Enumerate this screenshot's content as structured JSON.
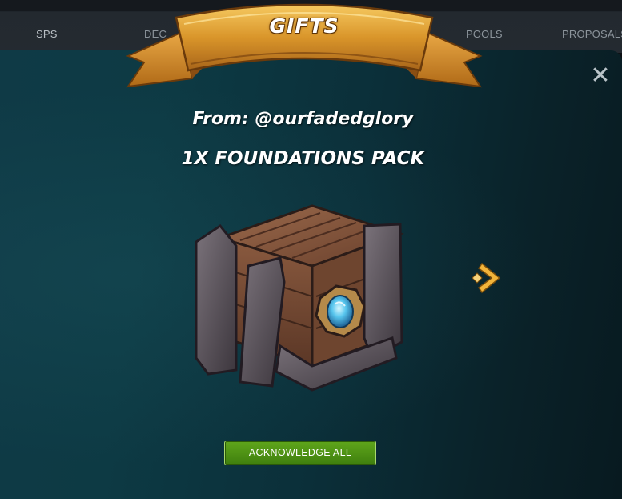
{
  "nav": {
    "items": [
      {
        "label": "SPS",
        "active": true
      },
      {
        "label": "DEC",
        "active": false
      },
      {
        "label": "POOLS",
        "active": false
      },
      {
        "label": "PROPOSALS",
        "active": false
      }
    ]
  },
  "modal": {
    "title": "GIFTS",
    "from_text": "From: @ourfadedglory",
    "gift_name": "1X FOUNDATIONS PACK",
    "acknowledge_label": "ACKNOWLEDGE ALL",
    "close_icon": "close-icon",
    "next_icon": "chevron-right-icon"
  },
  "colors": {
    "modal_bg": "#0d3a44",
    "banner_gold": "#d9a23a",
    "accent_arrow": "#f2b43a",
    "button_green": "#4f9314"
  }
}
